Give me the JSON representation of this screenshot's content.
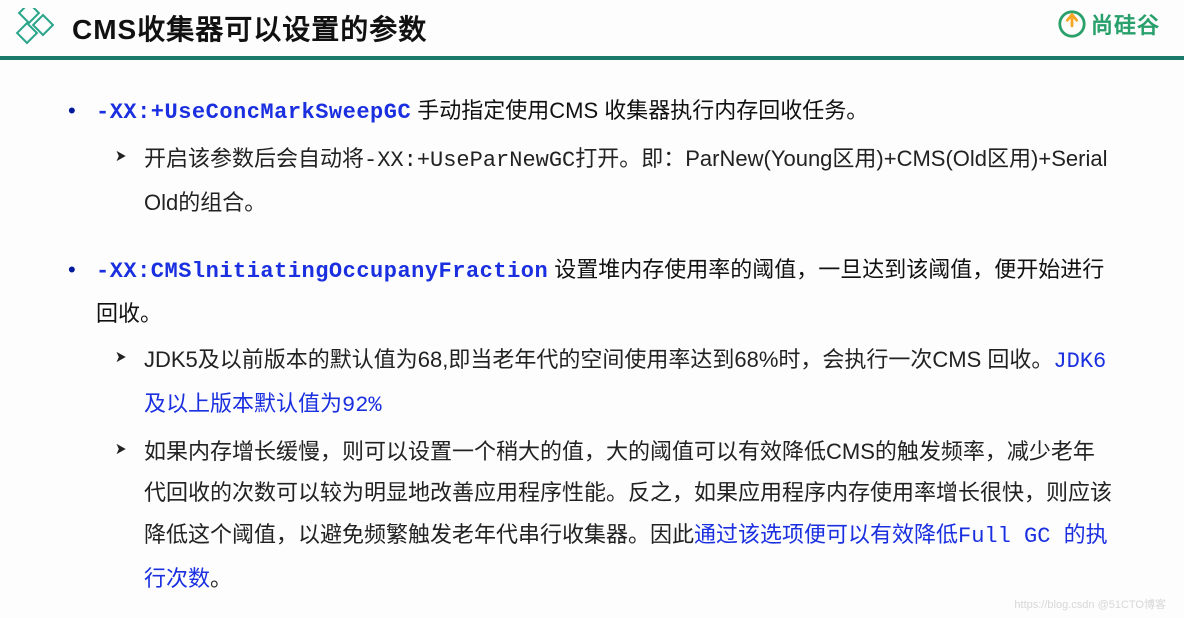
{
  "header": {
    "title": "CMS收集器可以设置的参数",
    "brand": "尚硅谷"
  },
  "list": {
    "item1_flag": "-XX:+UseConcMarkSweepGC",
    "item1_text": " 手动指定使用CMS 收集器执行内存回收任务。",
    "item1_sub1_a": "开启该参数后会自动将",
    "item1_sub1_mono": "-XX:+UseParNewGC",
    "item1_sub1_b": "打开。即：ParNew(Young区用)+CMS(Old区用)+Serial Old的组合。",
    "item2_flag": "-XX:CMSlnitiatingOccupanyFraction",
    "item2_text": " 设置堆内存使用率的阈值，一旦达到该阈值，便开始进行回收。",
    "item2_sub1_a": "JDK5及以前版本的默认值为68,即当老年代的空间使用率达到68%时，会执行一次CMS 回收。",
    "item2_sub1_hl": "JDK6及以上版本默认值为92%",
    "item2_sub2_a": "如果内存增长缓慢，则可以设置一个稍大的值，大的阈值可以有效降低CMS的触发频率，减少老年代回收的次数可以较为明显地改善应用程序性能。反之，如果应用程序内存使用率增长很快，则应该降低这个阈值，以避免频繁触发老年代串行收集器。因此",
    "item2_sub2_hl": "通过该选项便可以有效降低Full GC 的执行次数",
    "item2_sub2_b": "。"
  },
  "watermark": "https://blog.csdn @51CTO博客"
}
